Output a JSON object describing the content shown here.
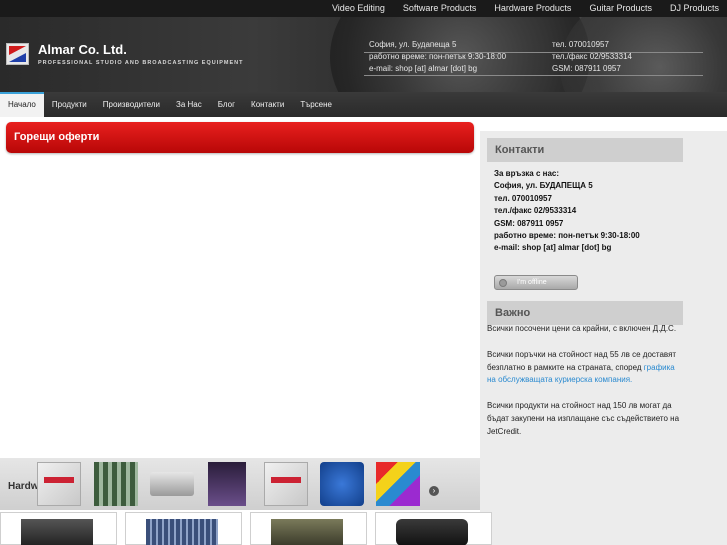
{
  "top_nav": [
    "Video Editing",
    "Software Products",
    "Hardware Products",
    "Guitar Products",
    "DJ Products"
  ],
  "brand": {
    "name": "Almar Co. Ltd.",
    "tagline": "PROFESSIONAL STUDIO AND BROADCASTING EQUIPMENT"
  },
  "header_contact": {
    "left": [
      "София, ул. Будапеща 5",
      "работно време: пон-петък 9:30-18:00",
      "e-mail: shop [at] almar [dot] bg"
    ],
    "right": [
      "тел. 070010957",
      "тел./факс 02/9533314",
      "GSM: 087911 0957"
    ]
  },
  "main_nav": [
    {
      "label": "Начало",
      "active": true
    },
    {
      "label": "Продукти"
    },
    {
      "label": "Производители"
    },
    {
      "label": "За Нас"
    },
    {
      "label": "Блог"
    },
    {
      "label": "Контакти"
    },
    {
      "label": "Търсене"
    }
  ],
  "hot_offers": "Горещи оферти",
  "sidebar": {
    "contacts_title": "Контакти",
    "contact_lines": [
      "За връзка с нас:",
      "София, ул. БУДАПЕЩА 5",
      "тел. 070010957",
      "тел./факс 02/9533314",
      "GSM: 087911 0957",
      "работно време: пон-петък 9:30-18:00",
      "e-mail: shop [at] almar [dot] bg"
    ],
    "chat_status": "I'm offline",
    "important_title": "Важно",
    "important": {
      "p1": "Всички посочени цени са крайни, с включен Д.Д.С.",
      "p2_before": "Всички поръчки на стойност над 55 лв се доставят безплатно в рамките на страната, според ",
      "p2_link": "графика на обслужващата куриерска компания.",
      "p3": "Всички продукти на стойност над 150 лв могат да бъдат закупени на изплащане със съдействието на JetCredit."
    }
  },
  "carousel": {
    "title": "Hardw"
  },
  "colors": {
    "accent_red": "#d01414",
    "link_blue": "#2a8ad0",
    "nav_active": "#3aa1d8"
  }
}
